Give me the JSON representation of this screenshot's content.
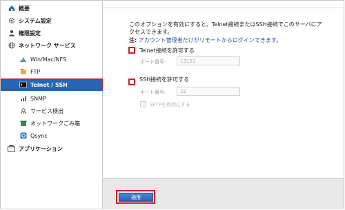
{
  "sidebar": {
    "items": [
      {
        "label": "概要",
        "icon": "home-icon"
      },
      {
        "label": "システム設定",
        "icon": "gear-icon"
      },
      {
        "label": "権限設定",
        "icon": "user-icon"
      },
      {
        "label": "ネットワーク サービス",
        "icon": "network-globe-icon"
      },
      {
        "label": "Win/Mac/NFS",
        "icon": "win-mac-icon"
      },
      {
        "label": "FTP",
        "icon": "ftp-icon"
      },
      {
        "label": "Telnet / SSH",
        "icon": "terminal-icon"
      },
      {
        "label": "SNMP",
        "icon": "snmp-icon"
      },
      {
        "label": "サービス検出",
        "icon": "service-discovery-icon"
      },
      {
        "label": "ネットワークごみ箱",
        "icon": "recycle-bin-icon"
      },
      {
        "label": "Qsync",
        "icon": "qsync-icon"
      },
      {
        "label": "アプリケーション",
        "icon": "application-icon"
      }
    ],
    "selected": "Telnet / SSH"
  },
  "main": {
    "description": "このオプションを有効にすると、Telnet接続またはSSH接続でこのサーバにアクセスできます。",
    "note_prefix": "注:",
    "note_text": "アカウント管理者だけがリモートからログインできます。",
    "telnet": {
      "label": "Telnet接続を許可する",
      "port_label": "ポート番号:",
      "port_value": "13131"
    },
    "ssh": {
      "label": "SSH接続を許可する",
      "port_label": "ポート番号:",
      "port_value": "22"
    },
    "sftp_label": "SFTPを有効にする"
  },
  "footer": {
    "apply_label": "適用"
  },
  "colors": {
    "selected_bg": "#2766b4",
    "highlight_red": "#d51d27",
    "note_blue": "#2b4f9c"
  }
}
